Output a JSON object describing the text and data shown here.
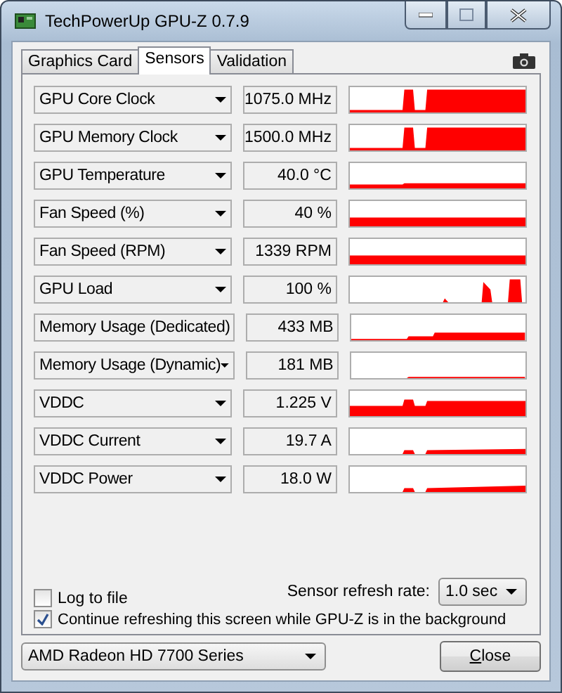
{
  "window": {
    "title": "TechPowerUp GPU-Z 0.7.9"
  },
  "tabs": [
    {
      "label": "Graphics Card",
      "selected": false
    },
    {
      "label": "Sensors",
      "selected": true
    },
    {
      "label": "Validation",
      "selected": false
    }
  ],
  "sensors": [
    {
      "name": "GPU Core Clock",
      "reading": "1075.0 MHz"
    },
    {
      "name": "GPU Memory Clock",
      "reading": "1500.0 MHz"
    },
    {
      "name": "GPU Temperature",
      "reading": "40.0 °C"
    },
    {
      "name": "Fan Speed (%)",
      "reading": "40 %"
    },
    {
      "name": "Fan Speed (RPM)",
      "reading": "1339 RPM"
    },
    {
      "name": "GPU Load",
      "reading": "100 %"
    },
    {
      "name": "Memory Usage (Dedicated)",
      "reading": "433 MB"
    },
    {
      "name": "Memory Usage (Dynamic)",
      "reading": "181 MB"
    },
    {
      "name": "VDDC",
      "reading": "1.225 V"
    },
    {
      "name": "VDDC Current",
      "reading": "19.7 A"
    },
    {
      "name": "VDDC Power",
      "reading": "18.0 W"
    }
  ],
  "log_to_file": {
    "label": "Log to file",
    "checked": false
  },
  "refresh_rate": {
    "label": "Sensor refresh rate:",
    "value": "1.0 sec"
  },
  "continue_refreshing": {
    "label": "Continue refreshing this screen while GPU-Z is in the background",
    "checked": true
  },
  "device": {
    "value": "AMD Radeon HD 7700 Series"
  },
  "close_button": "Close"
}
